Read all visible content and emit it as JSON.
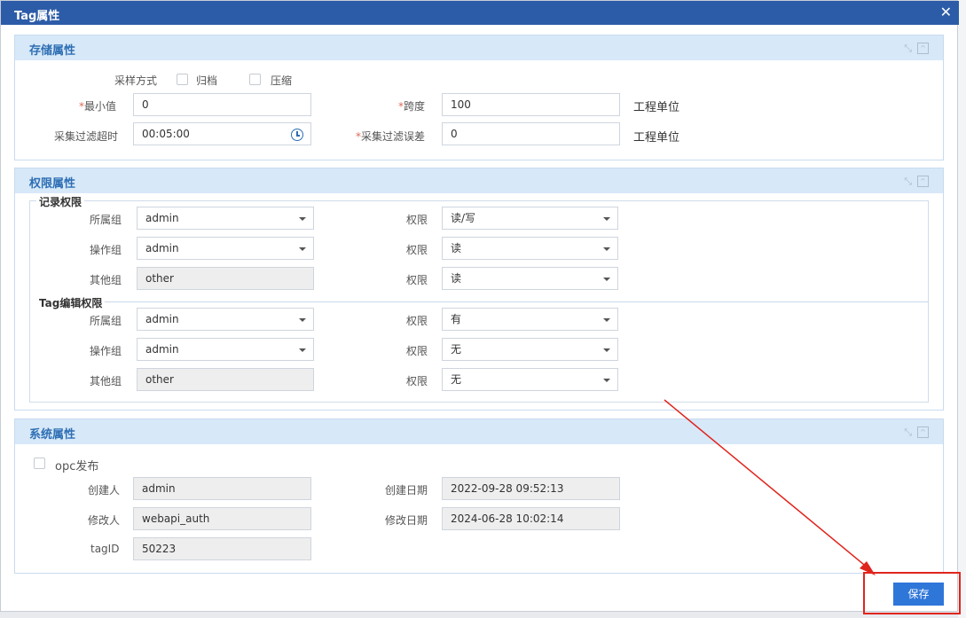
{
  "window": {
    "title": "Tag属性",
    "close_icon": "close-icon"
  },
  "storage": {
    "title": "存储属性",
    "sampling_label": "采样方式",
    "archive_label": "归档",
    "compress_label": "压缩",
    "min_label": "最小值",
    "min_value": "0",
    "span_label": "跨度",
    "span_value": "100",
    "unit1": "工程单位",
    "filter_timeout_label": "采集过滤超时",
    "filter_timeout_value": "00:05:00",
    "filter_error_label": "采集过滤误差",
    "filter_error_value": "0",
    "unit2": "工程单位"
  },
  "permission": {
    "title": "权限属性",
    "record_legend": "记录权限",
    "edit_legend": "Tag编辑权限",
    "perm_label": "权限",
    "record_rows": [
      {
        "group_label": "所属组",
        "group_value": "admin",
        "perm_value": "读/写"
      },
      {
        "group_label": "操作组",
        "group_value": "admin",
        "perm_value": "读"
      },
      {
        "group_label": "其他组",
        "group_value": "other",
        "perm_value": "读"
      }
    ],
    "edit_rows": [
      {
        "group_label": "所属组",
        "group_value": "admin",
        "perm_value": "有"
      },
      {
        "group_label": "操作组",
        "group_value": "admin",
        "perm_value": "无"
      },
      {
        "group_label": "其他组",
        "group_value": "other",
        "perm_value": "无"
      }
    ]
  },
  "system": {
    "title": "系统属性",
    "opc_label": "opc发布",
    "creator_label": "创建人",
    "creator_value": "admin",
    "created_date_label": "创建日期",
    "created_date_value": "2022-09-28 09:52:13",
    "modifier_label": "修改人",
    "modifier_value": "webapi_auth",
    "modified_date_label": "修改日期",
    "modified_date_value": "2024-06-28 10:02:14",
    "tagid_label": "tagID",
    "tagid_value": "50223"
  },
  "footer": {
    "save_label": "保存"
  },
  "colors": {
    "titlebar": "#2c5ca8",
    "panel_head": "#d7e8f8",
    "accent": "#2f76d9",
    "highlight": "#e0251e"
  }
}
